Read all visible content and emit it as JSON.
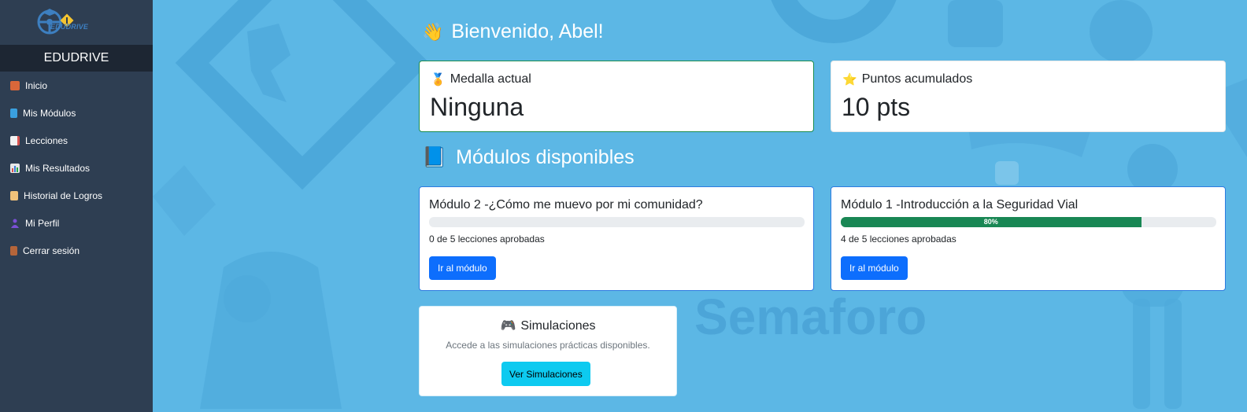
{
  "sidebar": {
    "logo_text": "EDUDRIVE",
    "brand": "EDUDRIVE",
    "items": [
      {
        "label": "Inicio",
        "icon": "house-icon"
      },
      {
        "label": "Mis Módulos",
        "icon": "book-icon"
      },
      {
        "label": "Lecciones",
        "icon": "memo-icon"
      },
      {
        "label": "Mis Resultados",
        "icon": "bar-chart-icon"
      },
      {
        "label": "Historial de Logros",
        "icon": "scroll-icon"
      },
      {
        "label": "Mi Perfil",
        "icon": "user-icon"
      },
      {
        "label": "Cerrar sesión",
        "icon": "door-icon"
      }
    ]
  },
  "welcome": "Bienvenido, Abel!",
  "stats": {
    "medal_label": "Medalla actual",
    "medal_value": "Ninguna",
    "points_label": "Puntos acumulados",
    "points_value": "10 pts"
  },
  "modules_title": "Módulos disponibles",
  "modules": [
    {
      "title": "Módulo 2 -¿Cómo me muevo por mi comunidad?",
      "progress": 0,
      "progress_label": "",
      "count": "0 de 5 lecciones aprobadas",
      "button": "Ir al módulo"
    },
    {
      "title": "Módulo 1 -Introducción a la Seguridad Vial",
      "progress": 80,
      "progress_label": "80%",
      "count": "4 de 5 lecciones aprobadas",
      "button": "Ir al módulo"
    }
  ],
  "simulations": {
    "title": "Simulaciones",
    "description": "Accede a las simulaciones prácticas disponibles.",
    "button": "Ver Simulaciones"
  },
  "background_watermark": "Semaforo",
  "colors": {
    "sidebar": "#2e3e52",
    "brand_bar": "#1d2633",
    "background": "#5cb7e5",
    "primary": "#0d6efd",
    "success": "#198754",
    "info": "#0dcaf0"
  }
}
